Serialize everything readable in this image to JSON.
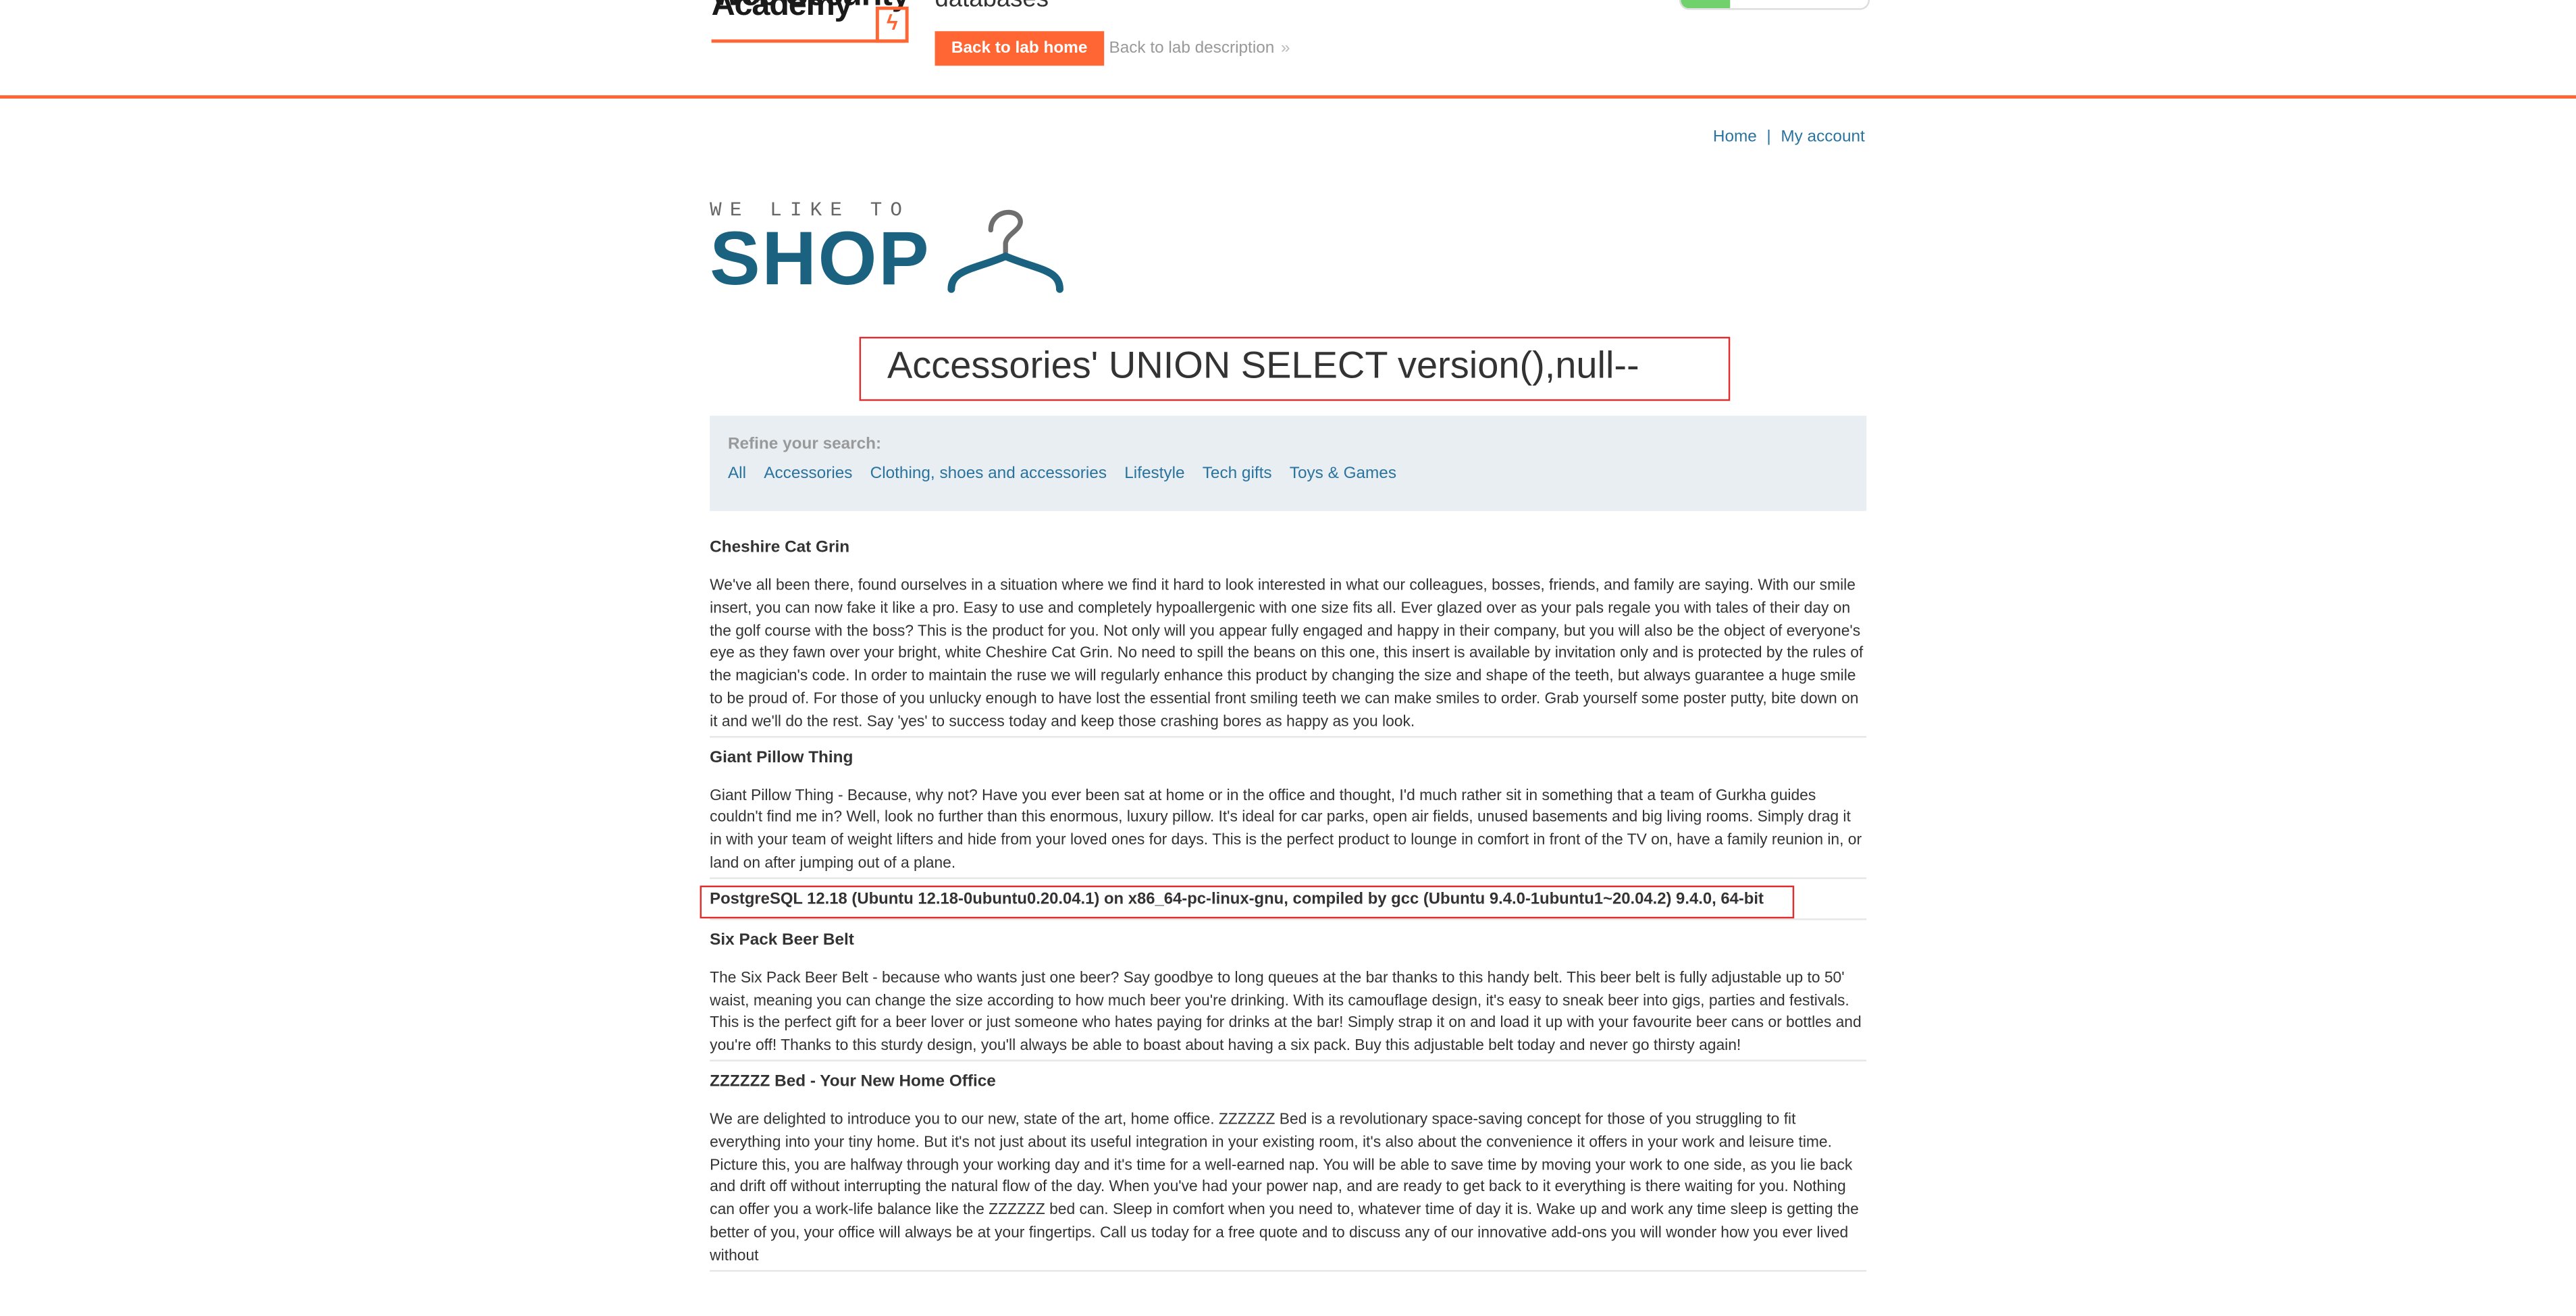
{
  "academy": {
    "logo_line1": "Web Security",
    "logo_line2": "Academy",
    "lab_title": "databases",
    "back_home_label": "Back to lab home",
    "back_description_label": "Back to lab description",
    "chevron": "»"
  },
  "nav": {
    "home": "Home",
    "separator": "|",
    "my_account": "My account"
  },
  "shop_logo": {
    "tagline": "WE LIKE TO",
    "word": "SHOP"
  },
  "page_heading": "Accessories' UNION SELECT version(),null--",
  "filters": {
    "label": "Refine your search:",
    "items": [
      "All",
      "Accessories",
      "Clothing, shoes and accessories",
      "Lifestyle",
      "Tech gifts",
      "Toys & Games"
    ]
  },
  "products": [
    {
      "title": "Cheshire Cat Grin",
      "description": "We've all been there, found ourselves in a situation where we find it hard to look interested in what our colleagues, bosses, friends, and family are saying. With our smile insert, you can now fake it like a pro. Easy to use and completely hypoallergenic with one size fits all. Ever glazed over as your pals regale you with tales of their day on the golf course with the boss? This is the product for you. Not only will you appear fully engaged and happy in their company, but you will also be the object of everyone's eye as they fawn over your bright, white Cheshire Cat Grin. No need to spill the beans on this one, this insert is available by invitation only and is protected by the rules of the magician's code. In order to maintain the ruse we will regularly enhance this product by changing the size and shape of the teeth, but always guarantee a huge smile to be proud of. For those of you unlucky enough to have lost the essential front smiling teeth we can make smiles to order. Grab yourself some poster putty, bite down on it and we'll do the rest. Say 'yes' to success today and keep those crashing bores as happy as you look."
    },
    {
      "title": "Giant Pillow Thing",
      "description": "Giant Pillow Thing - Because, why not? Have you ever been sat at home or in the office and thought, I'd much rather sit in something that a team of Gurkha guides couldn't find me in? Well, look no further than this enormous, luxury pillow. It's ideal for car parks, open air fields, unused basements and big living rooms. Simply drag it in with your team of weight lifters and hide from your loved ones for days. This is the perfect product to lounge in comfort in front of the TV on, have a family reunion in, or land on after jumping out of a plane."
    }
  ],
  "version_result": "PostgreSQL 12.18 (Ubuntu 12.18-0ubuntu0.20.04.1) on x86_64-pc-linux-gnu, compiled by gcc (Ubuntu 9.4.0-1ubuntu1~20.04.2) 9.4.0, 64-bit",
  "products_after": [
    {
      "title": "Six Pack Beer Belt",
      "description": "The Six Pack Beer Belt - because who wants just one beer? Say goodbye to long queues at the bar thanks to this handy belt. This beer belt is fully adjustable up to 50' waist, meaning you can change the size according to how much beer you're drinking. With its camouflage design, it's easy to sneak beer into gigs, parties and festivals. This is the perfect gift for a beer lover or just someone who hates paying for drinks at the bar! Simply strap it on and load it up with your favourite beer cans or bottles and you're off! Thanks to this sturdy design, you'll always be able to boast about having a six pack. Buy this adjustable belt today and never go thirsty again!"
    },
    {
      "title": "ZZZZZZ Bed - Your New Home Office",
      "description": "We are delighted to introduce you to our new, state of the art, home office. ZZZZZZ Bed is a revolutionary space-saving concept for those of you struggling to fit everything into your tiny home. But it's not just about its useful integration in your existing room, it's also about the convenience it offers in your work and leisure time. Picture this, you are halfway through your working day and it's time for a well-earned nap. You will be able to save time by moving your work to one side, as you lie back and drift off without interrupting the natural flow of the day. When you've had your power nap, and are ready to get back to it everything is there waiting for you. Nothing can offer you a work-life balance like the ZZZZZZ bed can. Sleep in comfort when you need to, whatever time of day it is. Wake up and work any time sleep is getting the better of you, your office will always be at your fingertips. Call us today for a free quote and to discuss any of our innovative add-ons you will wonder how you ever lived without"
    }
  ],
  "colors": {
    "accent": "#ff6633",
    "link": "#29739e",
    "logo_blue": "#1a6280",
    "highlight_border": "#e02d2d",
    "filter_bg": "#e8eef2"
  }
}
